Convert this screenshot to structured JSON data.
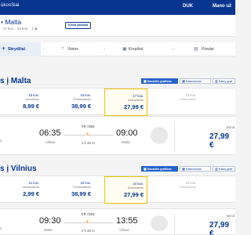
{
  "header": {
    "brand": "ūkosSiai",
    "language": "DUK",
    "account": "Mano už"
  },
  "route_bar": {
    "title": "• Malta",
    "subtitle": "· 17 kov. - 24 kov. · 1 ♟",
    "change_button": "Keisti paieška"
  },
  "steps": [
    {
      "label": "Skrydžiai",
      "icon": "plane-icon"
    },
    {
      "label": "Vietos",
      "icon": "seat-icon"
    },
    {
      "label": "Krepšiai",
      "icon": "bag-icon"
    },
    {
      "label": "Priedai",
      "icon": "extras-icon"
    }
  ],
  "outbound": {
    "title": "s į Malta",
    "views": [
      "Savaitės grafikas",
      "Kalendorius",
      "Kainų graf"
    ],
    "dates": [
      {
        "date": "15 kov.",
        "weekday": "rmadienis",
        "price": "8,99 €"
      },
      {
        "date": "16 kov.",
        "weekday": "Penktadienis",
        "price": "38,99 €"
      },
      {
        "date": "17 kov.",
        "weekday": "Antradienis",
        "price": "27,99 €",
        "selected": true
      },
      {
        "date": "18 kov.",
        "weekday": "Trečiadienis",
        "price": ""
      }
    ],
    "flight": {
      "dep_time": "06:35",
      "dep_city": "Vilnius",
      "dep_city_left": "s",
      "flight_no": "FR 7304",
      "duration": "3 h 25 m",
      "arr_time": "09:00",
      "arr_city": "Malta",
      "price_label": "Bend",
      "price": "27,99 €"
    }
  },
  "return": {
    "title": "s į Vilnius",
    "views": [
      "Savaitės grafikas",
      "Kalendorius",
      "Kainų graf"
    ],
    "dates": [
      {
        "date": "21 kov.",
        "weekday": "etvirtadienis",
        "price": "2,99 €"
      },
      {
        "date": "22 kov.",
        "weekday": "Penktadienis",
        "price": "38,99 €"
      },
      {
        "date": "24 kov.",
        "weekday": "Antradienis",
        "price": "27,99 €",
        "selected": true
      },
      {
        "date": "25 kov.",
        "weekday": "Trečiadienis",
        "price": ""
      }
    ],
    "flight": {
      "dep_time": "09:30",
      "dep_city": "Malta",
      "dep_city_left": "s",
      "flight_no": "FR 7303",
      "duration": "3 h 25 m",
      "arr_time": "13:55",
      "arr_city": "Vilnius",
      "price_label": "Bend",
      "price": "27,99 €"
    }
  },
  "colors": {
    "brand": "#073590",
    "accent": "#f2c200",
    "active_button": "#2563c9"
  }
}
